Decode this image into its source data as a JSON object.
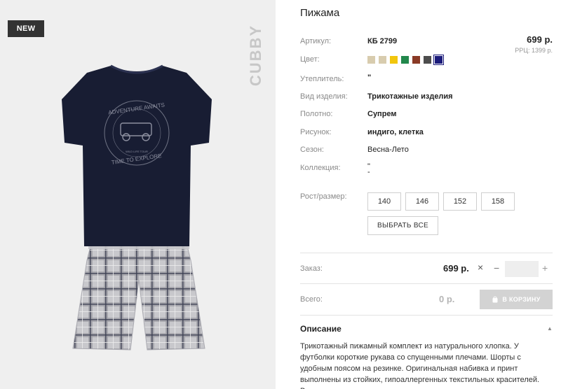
{
  "badge": "NEW",
  "brand_mark": "CUBBY",
  "product": {
    "title": "Пижама",
    "article_label": "Артикул:",
    "article_value": "КБ 2799",
    "price": "699 р.",
    "rrp": "РРЦ: 1399 р.",
    "color_label": "Цвет:",
    "colors": [
      "#d8ccae",
      "#d8ccae",
      "#f2c60d",
      "#22884c",
      "#8a3a26",
      "#4d4d4d",
      "#1b1b7a"
    ],
    "selected_color_index": 6,
    "insulation_label": "Утеплитель:",
    "insulation_value": "\"",
    "type_label": "Вид изделия:",
    "type_value": "Трикотажные изделия",
    "fabric_label": "Полотно:",
    "fabric_value": "Супрем",
    "pattern_label": "Рисунок:",
    "pattern_value": "индиго, клетка",
    "season_label": "Сезон:",
    "season_value": "Весна-Лето",
    "collection_label": "Коллекция:",
    "collection_value": "\"",
    "collection_value2": "-",
    "size_label": "Рост/размер:",
    "sizes": [
      "140",
      "146",
      "152",
      "158"
    ],
    "select_all": "ВЫБРАТЬ ВСЕ"
  },
  "order": {
    "label": "Заказ:",
    "price": "699 р.",
    "times_icon": "×",
    "minus_icon": "−",
    "plus_icon": "+",
    "quantity": ""
  },
  "total": {
    "label": "Всего:",
    "value": "0 р.",
    "cart_button": "В КОРЗИНУ",
    "cart_icon": "bag-icon"
  },
  "description": {
    "title": "Описание",
    "text": "Трикотажный пижамный комплект из натурального хлопка. У футболки короткие рукава со спущенными плечами. Шорты с удобным поясом на резинке. Оригинальная набивка и принт выполнены из стойких, гипоаллергенных текстильных красителей. Все трикотажные полотна производятся в соответствии с нормами"
  }
}
